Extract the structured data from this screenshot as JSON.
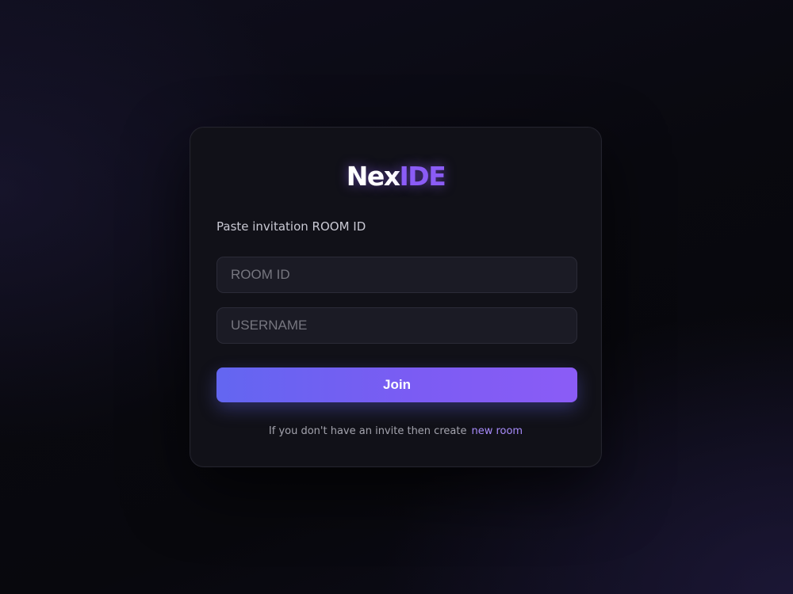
{
  "logo": {
    "part1": "Nex",
    "part2": "IDE"
  },
  "form": {
    "label": "Paste invitation ROOM ID",
    "room_id": {
      "value": "",
      "placeholder": "ROOM ID"
    },
    "username": {
      "value": "",
      "placeholder": "USERNAME"
    },
    "join_label": "Join"
  },
  "footer": {
    "text": "If you don't have an invite then create",
    "link_label": "new room"
  },
  "colors": {
    "accent": "#8b5cf6",
    "button_gradient_start": "#6366f1",
    "button_gradient_end": "#8b5cf6",
    "link": "#a78bfa",
    "card_background": "#111118",
    "page_background": "#09090f"
  }
}
